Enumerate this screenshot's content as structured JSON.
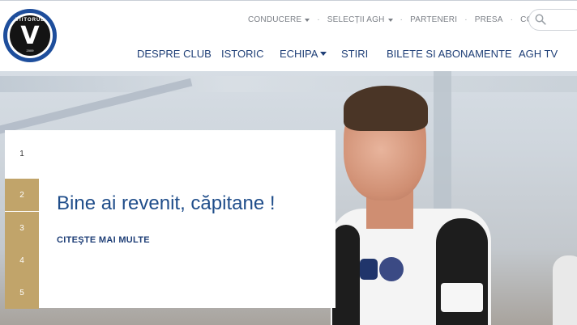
{
  "logo": {
    "top_text": "VIITORUL",
    "letter": "V",
    "year": "2009"
  },
  "top_nav": {
    "items": [
      {
        "label": "CONDUCERE",
        "has_dropdown": true
      },
      {
        "label": "SELECȚII AGH",
        "has_dropdown": true
      },
      {
        "label": "PARTENERI",
        "has_dropdown": false
      },
      {
        "label": "PRESA",
        "has_dropdown": false
      },
      {
        "label": "CONTACT",
        "has_dropdown": false
      }
    ],
    "separator": "·"
  },
  "search": {
    "placeholder": "",
    "icon": "search-icon"
  },
  "main_nav": {
    "items": [
      {
        "label": "DESPRE CLUB"
      },
      {
        "label": "ISTORIC"
      },
      {
        "label": "ECHIPA",
        "has_dropdown": true
      },
      {
        "label": "STIRI"
      },
      {
        "label": "BILETE SI ABONAMENTE"
      },
      {
        "label": "AGH TV"
      }
    ]
  },
  "slider": {
    "tabs": [
      "1",
      "2",
      "3",
      "4",
      "5"
    ],
    "active_index": 0,
    "title": "Bine ai revenit, căpitane !",
    "link": "CITEŞTE MAI MULTE"
  },
  "colors": {
    "brand_blue": "#1f4d8a",
    "nav_blue": "#1f3f77",
    "tab_gold": "#c1a46a",
    "logo_blue": "#1e4e9c"
  }
}
